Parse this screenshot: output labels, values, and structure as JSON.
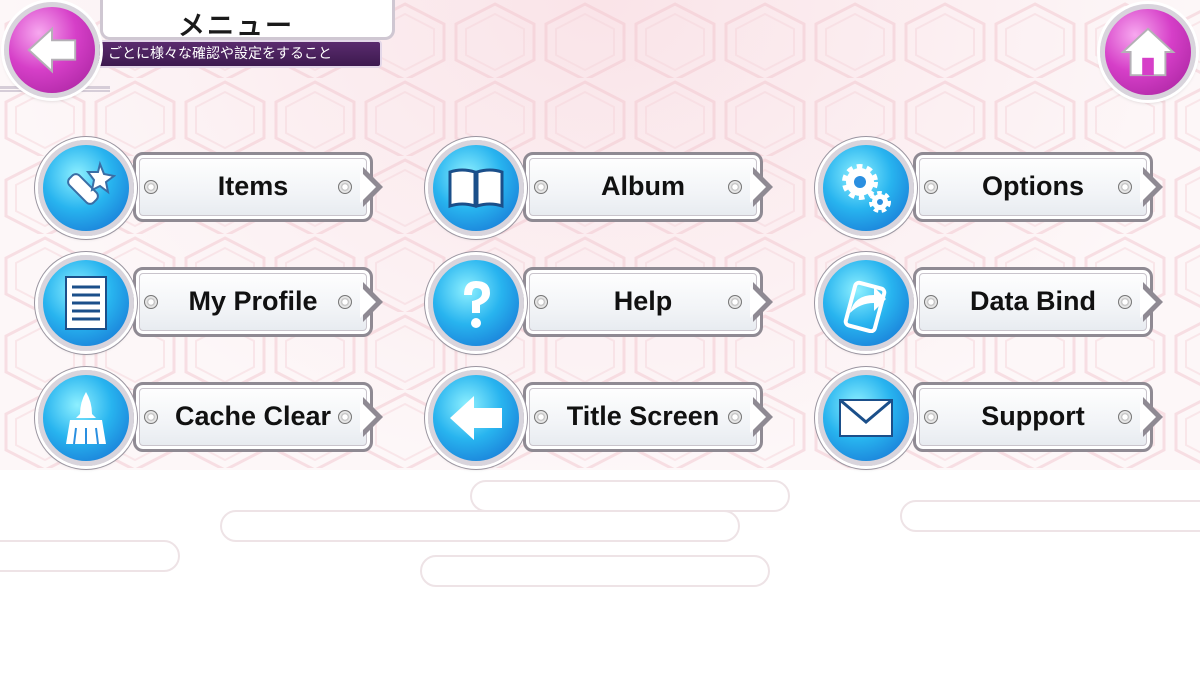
{
  "header": {
    "title": "メニュー",
    "subtitle": "ごとに様々な確認や設定をすること"
  },
  "colors": {
    "menu_circle": "#28b4ef",
    "nav_button": "#d63fc8",
    "subtitle_bar": "#4a2260"
  },
  "menu": {
    "items": [
      {
        "label": "Items",
        "icon": "items-icon"
      },
      {
        "label": "Album",
        "icon": "album-icon"
      },
      {
        "label": "Options",
        "icon": "gear-icon"
      },
      {
        "label": "My Profile",
        "icon": "profile-icon"
      },
      {
        "label": "Help",
        "icon": "question-icon"
      },
      {
        "label": "Data Bind",
        "icon": "data-bind-icon"
      },
      {
        "label": "Cache Clear",
        "icon": "broom-icon"
      },
      {
        "label": "Title Screen",
        "icon": "arrow-left-icon"
      },
      {
        "label": "Support",
        "icon": "mail-icon"
      }
    ]
  }
}
